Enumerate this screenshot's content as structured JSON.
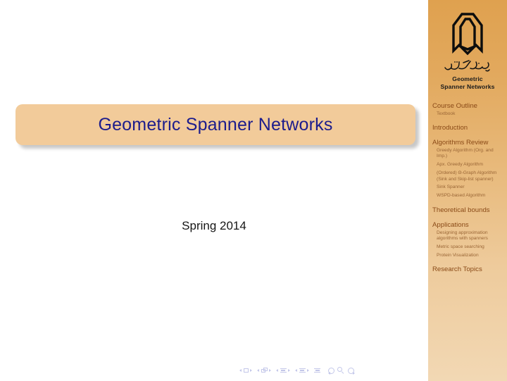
{
  "slide": {
    "title": "Geometric Spanner Networks",
    "subtitle": "Spring 2014",
    "title_text_color": "#1c1c8c",
    "title_box_color": "#f2cb9a"
  },
  "sidebar": {
    "background_top_color": "#dfa14f",
    "background_bottom_color": "#f2d8b4",
    "section_color": "#8a4a17",
    "subsection_color": "#9a6636",
    "logo": {
      "icon": "yazd-university-logo-icon",
      "persian_text": "دانشگاه یزد",
      "caption_line1": "Geometric",
      "caption_line2": "Spanner Networks"
    },
    "nav": [
      {
        "label": "Course Outline",
        "level": "section"
      },
      {
        "label": "Textbook",
        "level": "subsection"
      },
      {
        "label": "Introduction",
        "level": "section"
      },
      {
        "label": "Algorithms Review",
        "level": "section"
      },
      {
        "label": "Greedy Algorithm (Org. and Imp.)",
        "level": "subsection"
      },
      {
        "label": "Apx. Greedy Algorithm",
        "level": "subsection"
      },
      {
        "label": "(Ordered) Θ-Graph Algorithm (Sink and Skip-list spanner)",
        "level": "subsection"
      },
      {
        "label": "Sink Spanner",
        "level": "subsection"
      },
      {
        "label": "WSPD-based Algorithm",
        "level": "subsection"
      },
      {
        "label": "Theoretical bounds",
        "level": "section"
      },
      {
        "label": "Applications",
        "level": "section"
      },
      {
        "label": "Designing approximation algorithms with spanners",
        "level": "subsection"
      },
      {
        "label": "Metric space searching",
        "level": "subsection"
      },
      {
        "label": "Protein Visualization",
        "level": "subsection"
      },
      {
        "label": "Research Topics",
        "level": "section"
      }
    ]
  },
  "navigation_symbols": {
    "color": "#b9bee6",
    "items": [
      "previous-slide-icon",
      "slide-icon",
      "next-slide-icon",
      "previous-frame-icon",
      "frame-icon",
      "next-frame-icon",
      "previous-subsection-icon",
      "subsection-icon",
      "next-subsection-icon",
      "previous-section-icon",
      "section-icon",
      "next-section-icon",
      "document-icon",
      "back-icon",
      "search-icon",
      "forward-icon"
    ]
  }
}
